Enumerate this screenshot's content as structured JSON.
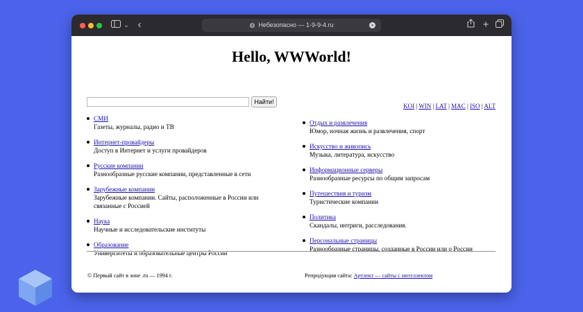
{
  "browser": {
    "address": "Небезопасно — 1-9-9-4.ru",
    "icons": [
      "sidebar-icon",
      "chevron-down-icon",
      "back-icon",
      "globe-icon",
      "ellipsis-icon",
      "share-icon",
      "plus-icon",
      "tabs-icon"
    ]
  },
  "page": {
    "title": "Hello, WWWorld!",
    "search_button": "Найти!",
    "search_value": "",
    "encodings": [
      "KOI",
      "WIN",
      "LAT",
      "MAC",
      "ISO",
      "ALT"
    ],
    "left_items": [
      {
        "link": "СМИ",
        "desc": "Газеты, журналы, радио и ТВ"
      },
      {
        "link": "Интернет-провайдеры",
        "desc": "Доступ в Интернет и услуги провайдеров"
      },
      {
        "link": "Русские компании",
        "desc": "Разнообразные русские компании, представленные в сети"
      },
      {
        "link": "Зарубежные компании",
        "desc": "Зарубежные компании. Сайты, расположенные в России или связанные с Россией"
      },
      {
        "link": "Наука",
        "desc": "Научные и исследовательские институты"
      },
      {
        "link": "Образование",
        "desc": "Университеты и образовательные центры России"
      }
    ],
    "right_items": [
      {
        "link": "Отдых и развлечения",
        "desc": "Юмор, ночная жизнь и развлечения, спорт"
      },
      {
        "link": "Искусство и живопись",
        "desc": "Музыка, литература, искусство"
      },
      {
        "link": "Информационные серверы",
        "desc": "Разнообразные ресурсы по общим запросам"
      },
      {
        "link": "Путешествия и туризм",
        "desc": "Туристические компании"
      },
      {
        "link": "Политика",
        "desc": "Скандалы, интриги, расследования."
      },
      {
        "link": "Персональные страницы",
        "desc": "Разнообразные страницы, созданные в России или о России"
      }
    ],
    "footer_left": "© Первый сайт в зоне .ru — 1994 г.",
    "footer_right_label": "Репродукция сайта:",
    "footer_right_link": "Артлект — сайты с интеллектом"
  },
  "colors": {
    "background": "#4a63ea",
    "link": "#1a0dab",
    "titlebar": "#2b2a2e"
  }
}
